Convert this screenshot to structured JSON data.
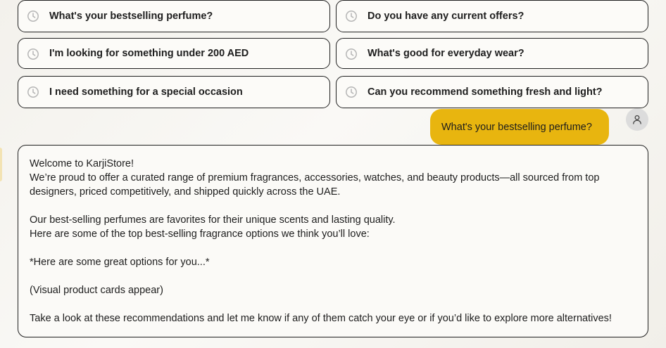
{
  "suggestions": [
    {
      "label": "What's your bestselling perfume?"
    },
    {
      "label": "Do you have any current offers?"
    },
    {
      "label": "I'm looking for something under 200 AED"
    },
    {
      "label": "What's good for everyday wear?"
    },
    {
      "label": "I need something for a special occasion"
    },
    {
      "label": "Can you recommend something fresh and light?"
    }
  ],
  "suggestion_icon": "history-clock-icon",
  "user_message": {
    "text": "What's your bestselling perfume?",
    "avatar_icon": "user-icon"
  },
  "bot_message": {
    "lines": [
      "Welcome to KarjiStore!",
      "We’re proud to offer a curated range of premium fragrances, accessories, watches, and beauty products—all sourced from top",
      "designers, priced competitively, and shipped quickly across the UAE.",
      "",
      "Our best-selling perfumes are favorites for their unique scents and lasting quality.",
      "Here are some of the top best-selling fragrance options we think you’ll love:",
      "",
      "*Here are some great options for you...*",
      "",
      "(Visual product cards appear)",
      "",
      "Take a look at these recommendations and let me know if any of them catch your eye or if you’d like to explore more alternatives!"
    ]
  },
  "colors": {
    "accent": "#e8b50f",
    "border": "#1f1f1f",
    "avatar_bg": "#dcdcdc"
  }
}
